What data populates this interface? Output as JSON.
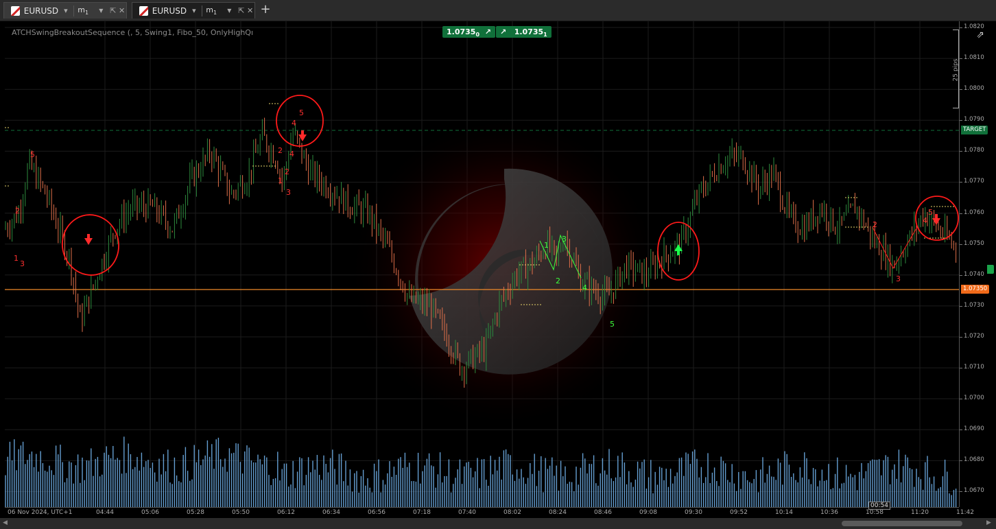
{
  "tabs": [
    {
      "symbol": "EURUSD",
      "timeframe": "m",
      "timeframe_sub": "1",
      "active": false
    },
    {
      "symbol": "EURUSD",
      "timeframe": "m",
      "timeframe_sub": "1",
      "active": true
    }
  ],
  "indicator_label": "ATCHSwingBreakoutSequence (, 5, Swing1, Fibo_50, OnlyHighQı",
  "bid": {
    "main": "1.0735",
    "sub": "0"
  },
  "ask": {
    "main": "1.0735",
    "sub": "1"
  },
  "pips_ruler": "25 pips",
  "target_label": "TARGET",
  "price_label": "1.07350",
  "timer": "00:54",
  "date_label": "06 Nov 2024, UTC+1",
  "price_ticks": [
    "1.0820",
    "1.0810",
    "1.0800",
    "1.0790",
    "1.0780",
    "1.0770",
    "1.0760",
    "1.0750",
    "1.0740",
    "1.0730",
    "1.0720",
    "1.0710",
    "1.0700",
    "1.0690",
    "1.0680",
    "1.0670"
  ],
  "time_ticks": [
    "04:44",
    "05:06",
    "05:28",
    "05:50",
    "06:12",
    "06:34",
    "06:56",
    "07:18",
    "07:40",
    "08:02",
    "08:24",
    "08:46",
    "09:08",
    "09:30",
    "09:52",
    "10:14",
    "10:36",
    "10:58",
    "11:20",
    "11:42"
  ],
  "colors": {
    "bull": "#2e8b3e",
    "bear": "#e0704a",
    "volume": "#6fb0e8",
    "target": "#10703a",
    "price_line": "#f08a2a",
    "annotation": "#ff1a1a",
    "swing_green": "#3cff3c"
  },
  "swing_labels_red": [
    "5",
    "2",
    "1",
    "3",
    "5",
    "4",
    "2",
    "4",
    "2",
    "1",
    "3",
    "2",
    "3",
    "4",
    "5"
  ],
  "swing_labels_green": [
    "1",
    "3",
    "2",
    "4",
    "5"
  ],
  "chart_data": {
    "type": "candlestick",
    "xlabel": "",
    "ylabel": "",
    "ylim": [
      1.0665,
      1.0822
    ],
    "target": 1.0786,
    "current_price": 1.0735,
    "key_points": [
      [
        0,
        1.0755
      ],
      [
        20,
        1.076
      ],
      [
        35,
        1.0776
      ],
      [
        60,
        1.0766
      ],
      [
        80,
        1.0754
      ],
      [
        95,
        1.0745
      ],
      [
        110,
        1.0725
      ],
      [
        135,
        1.074
      ],
      [
        160,
        1.0755
      ],
      [
        185,
        1.0762
      ],
      [
        215,
        1.0762
      ],
      [
        245,
        1.0755
      ],
      [
        270,
        1.077
      ],
      [
        300,
        1.078
      ],
      [
        330,
        1.0766
      ],
      [
        355,
        1.0772
      ],
      [
        375,
        1.0785
      ],
      [
        395,
        1.0778
      ],
      [
        405,
        1.077
      ],
      [
        420,
        1.0786
      ],
      [
        445,
        1.0773
      ],
      [
        475,
        1.0768
      ],
      [
        500,
        1.0763
      ],
      [
        530,
        1.076
      ],
      [
        560,
        1.0748
      ],
      [
        590,
        1.0732
      ],
      [
        620,
        1.073
      ],
      [
        645,
        1.072
      ],
      [
        665,
        1.071
      ],
      [
        700,
        1.0716
      ],
      [
        720,
        1.073
      ],
      [
        745,
        1.074
      ],
      [
        770,
        1.0744
      ],
      [
        790,
        1.075
      ],
      [
        805,
        1.0745
      ],
      [
        815,
        1.0753
      ],
      [
        840,
        1.0738
      ],
      [
        860,
        1.0735
      ],
      [
        880,
        1.0733
      ],
      [
        905,
        1.0743
      ],
      [
        935,
        1.074
      ],
      [
        960,
        1.0746
      ],
      [
        985,
        1.075
      ],
      [
        1010,
        1.0765
      ],
      [
        1040,
        1.0775
      ],
      [
        1055,
        1.0778
      ],
      [
        1075,
        1.0778
      ],
      [
        1100,
        1.0768
      ],
      [
        1120,
        1.0773
      ],
      [
        1145,
        1.0758
      ],
      [
        1165,
        1.0755
      ],
      [
        1190,
        1.0762
      ],
      [
        1215,
        1.0755
      ],
      [
        1240,
        1.0762
      ],
      [
        1265,
        1.0752
      ],
      [
        1295,
        1.0743
      ],
      [
        1320,
        1.0752
      ],
      [
        1340,
        1.076
      ],
      [
        1360,
        1.0755
      ],
      [
        1391,
        1.0748
      ]
    ]
  }
}
